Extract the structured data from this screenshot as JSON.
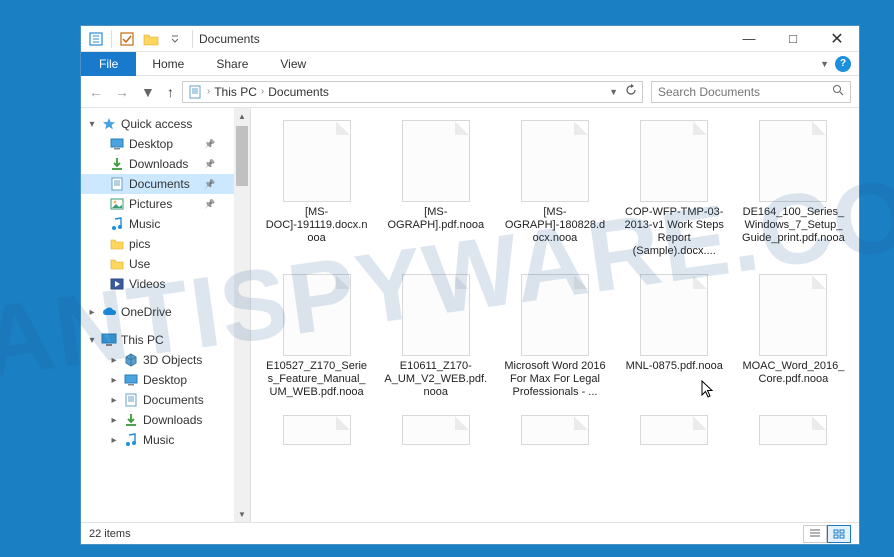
{
  "window": {
    "title": "Documents"
  },
  "ribbon": {
    "file": "File",
    "tabs": [
      "Home",
      "Share",
      "View"
    ]
  },
  "breadcrumb": {
    "root": "This PC",
    "current": "Documents"
  },
  "search": {
    "placeholder": "Search Documents"
  },
  "tree": {
    "quick_access": "Quick access",
    "items_qa": [
      {
        "label": "Desktop",
        "pin": true,
        "icon": "desktop"
      },
      {
        "label": "Downloads",
        "pin": true,
        "icon": "downloads"
      },
      {
        "label": "Documents",
        "pin": true,
        "icon": "documents",
        "selected": true
      },
      {
        "label": "Pictures",
        "pin": true,
        "icon": "pictures"
      },
      {
        "label": "Music",
        "pin": false,
        "icon": "music"
      },
      {
        "label": "pics",
        "pin": false,
        "icon": "folder"
      },
      {
        "label": "Use",
        "pin": false,
        "icon": "folder"
      },
      {
        "label": "Videos",
        "pin": false,
        "icon": "videos"
      }
    ],
    "onedrive": "OneDrive",
    "thispc": "This PC",
    "items_pc": [
      {
        "label": "3D Objects",
        "icon": "3d"
      },
      {
        "label": "Desktop",
        "icon": "desktop"
      },
      {
        "label": "Documents",
        "icon": "documents"
      },
      {
        "label": "Downloads",
        "icon": "downloads"
      },
      {
        "label": "Music",
        "icon": "music"
      }
    ]
  },
  "files": [
    "[MS-DOC]-191119.docx.nooa",
    "[MS-OGRAPH].pdf.nooa",
    "[MS-OGRAPH]-180828.docx.nooa",
    "COP-WFP-TMP-03-2013-v1 Work Steps Report (Sample).docx....",
    "DE164_100_Series_Windows_7_Setup_Guide_print.pdf.nooa",
    "E10527_Z170_Series_Feature_Manual_UM_WEB.pdf.nooa",
    "E10611_Z170-A_UM_V2_WEB.pdf.nooa",
    "Microsoft Word 2016 For Max For Legal Professionals - ...",
    "MNL-0875.pdf.nooa",
    "MOAC_Word_2016_Core.pdf.nooa"
  ],
  "status": {
    "items": "22 items"
  }
}
